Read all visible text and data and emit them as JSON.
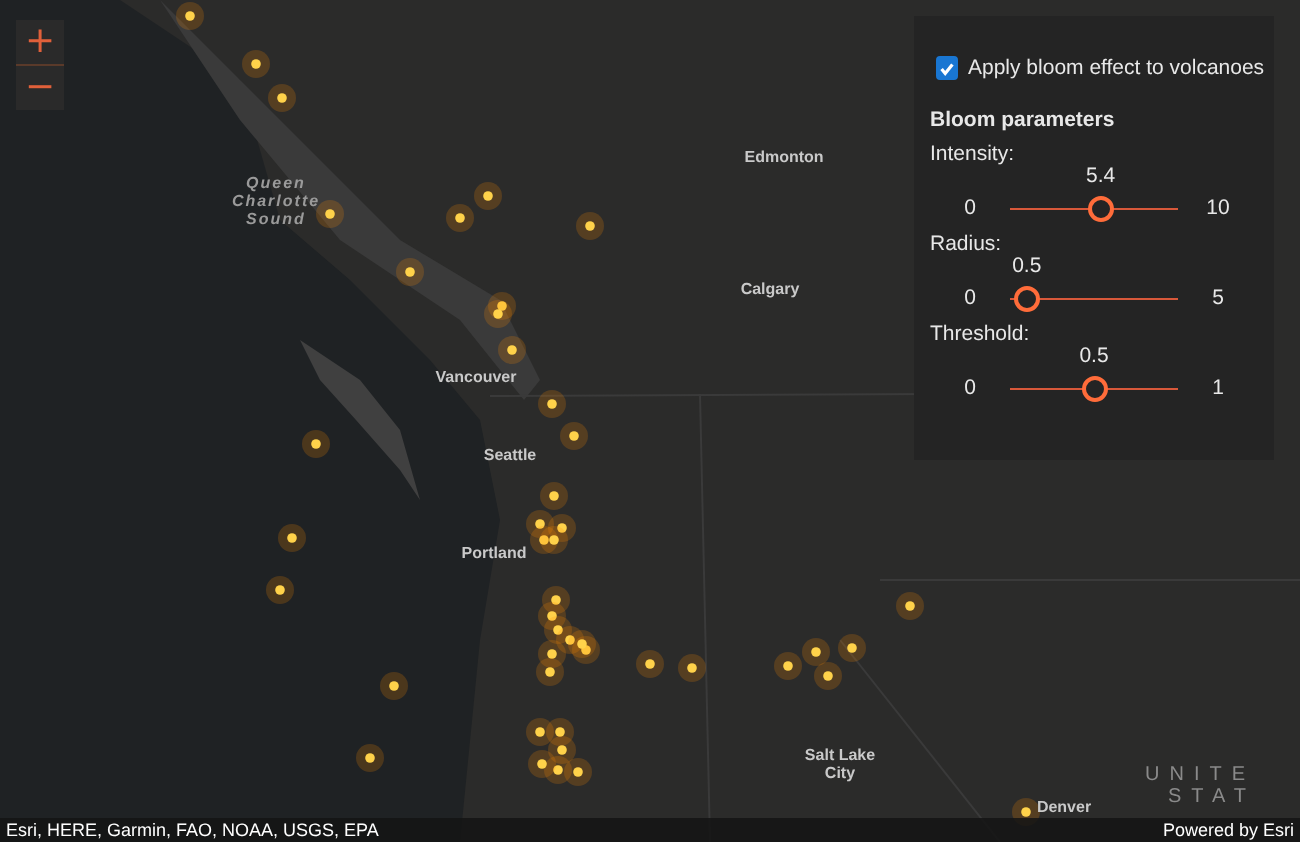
{
  "zoom_controls": [
    {
      "label": "+"
    },
    {
      "label": "−"
    }
  ],
  "map": {
    "labels": [
      {
        "text": "Edmonton",
        "kind": "city"
      },
      {
        "text": "Calgary",
        "kind": "city"
      },
      {
        "text": "Queen\nCharlotte\nSound",
        "kind": "water"
      },
      {
        "text": "Vancouver",
        "kind": "city"
      },
      {
        "text": "Seattle",
        "kind": "city"
      },
      {
        "text": "Portland",
        "kind": "city"
      },
      {
        "text": "Salt Lake\nCity",
        "kind": "city"
      },
      {
        "text": "Denver",
        "kind": "city"
      },
      {
        "text": "UNITE",
        "kind": "country"
      },
      {
        "text": "STAT",
        "kind": "country"
      }
    ]
  },
  "panel": {
    "bloom_toggle": {
      "label": "Apply bloom effect to volcanoes",
      "checked": true
    },
    "heading": "Bloom parameters",
    "sliders": [
      {
        "label": "Intensity:",
        "min": "0",
        "max": "10",
        "value": "5.4",
        "level": 0.54
      },
      {
        "label": "Radius:",
        "min": "0",
        "max": "5",
        "value": "0.5",
        "level": 0.1
      },
      {
        "label": "Threshold:",
        "min": "0",
        "max": "1",
        "value": "0.5",
        "level": 0.5
      }
    ]
  },
  "attribution": {
    "sources": "Esri, HERE, Garmin, FAO, NOAA, USGS, EPA",
    "powered_by": "Powered by Esri"
  }
}
